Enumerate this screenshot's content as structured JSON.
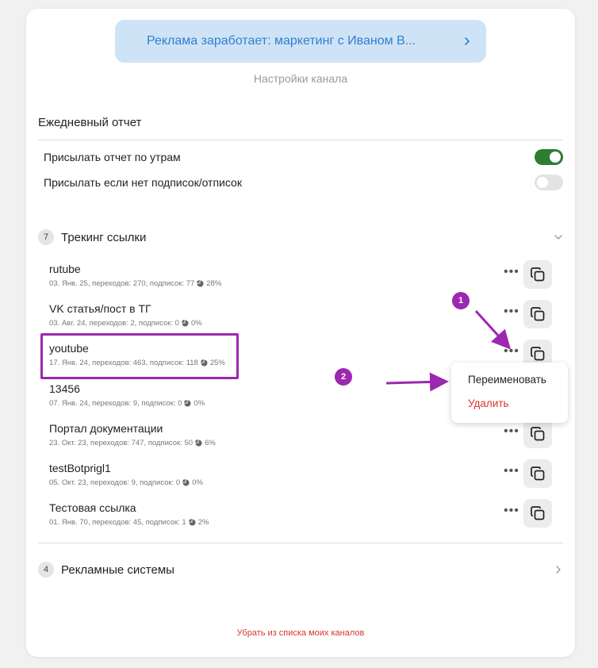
{
  "header": {
    "channel_title": "Реклама заработает: маркетинг с Иваном В...",
    "subtitle": "Настройки канала"
  },
  "daily_report": {
    "title": "Ежедневный отчет",
    "toggles": [
      {
        "label": "Присылать отчет по утрам",
        "on": true
      },
      {
        "label": "Присылать если нет подписок/отписок",
        "on": false
      }
    ]
  },
  "tracking": {
    "count": "7",
    "title": "Трекинг ссылки",
    "links": [
      {
        "name": "rutube",
        "meta": "03. Янв. 25, переходов: 270, подписок: 77",
        "pct": "28%"
      },
      {
        "name": "VK статья/пост в ТГ",
        "meta": "03. Авг. 24, переходов: 2, подписок: 0",
        "pct": "0%"
      },
      {
        "name": "youtube",
        "meta": "17. Янв. 24, переходов: 463, подписок: 118",
        "pct": "25%"
      },
      {
        "name": "13456",
        "meta": "07. Янв. 24, переходов: 9, подписок: 0",
        "pct": "0%"
      },
      {
        "name": "Портал документации",
        "meta": "23. Окт. 23, переходов: 747, подписок: 50",
        "pct": "6%"
      },
      {
        "name": "testBotprigl1",
        "meta": "05. Окт. 23, переходов: 9, подписок: 0",
        "pct": "0%"
      },
      {
        "name": "Тестовая ссылка",
        "meta": "01. Янв. 70, переходов: 45, подписок: 1",
        "pct": "2%"
      }
    ]
  },
  "context_menu": {
    "rename": "Переименовать",
    "delete": "Удалить"
  },
  "ad_systems": {
    "count": "4",
    "title": "Рекламные системы"
  },
  "footer": {
    "remove_label": "Убрать из списка моих каналов"
  },
  "annotations": {
    "marker_1": "1",
    "marker_2": "2"
  },
  "colors": {
    "accent_blue": "#2f7fd1",
    "toggle_on": "#2e7d32",
    "danger": "#d9342b",
    "annotation": "#9c27b0"
  }
}
